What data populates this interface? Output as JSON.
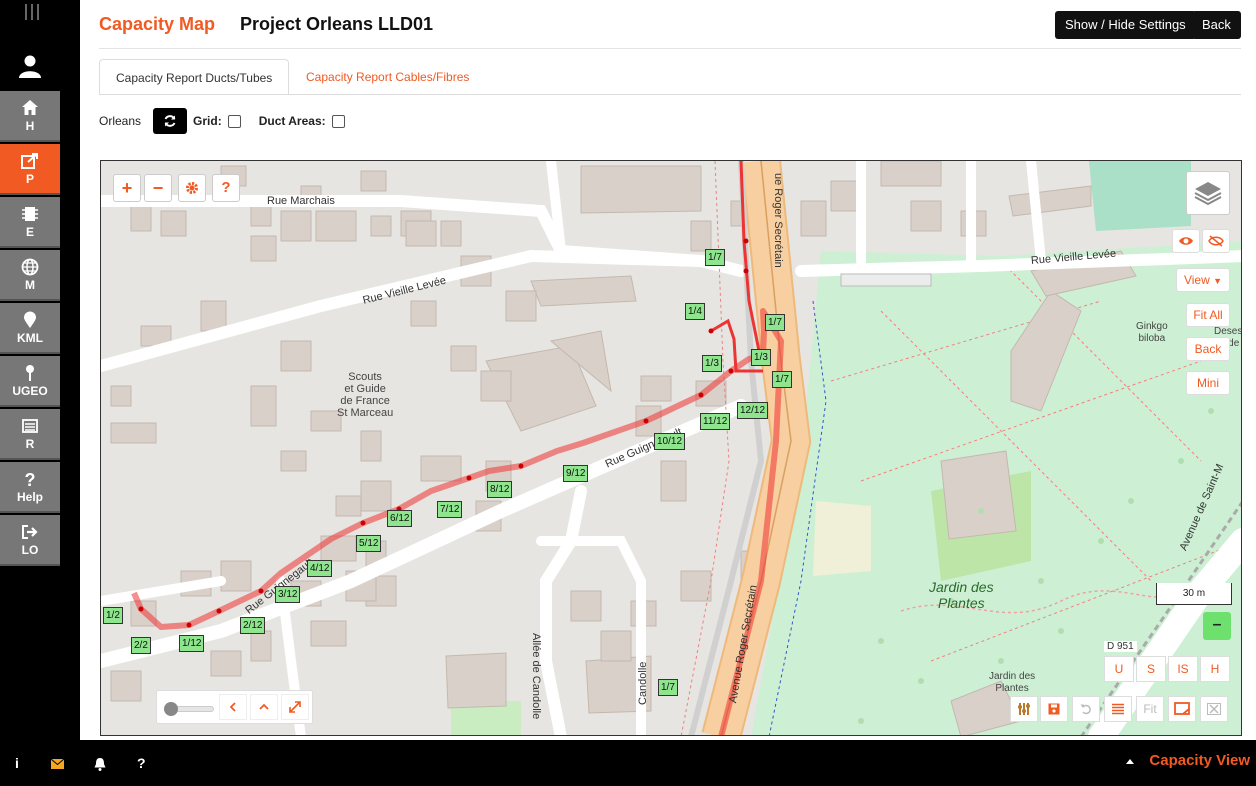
{
  "header": {
    "brand": "Capacity Map",
    "project": "Project Orleans LLD01",
    "show_hide_settings": "Show / Hide Settings",
    "back": "Back"
  },
  "sidebar": {
    "items": [
      {
        "label": "H",
        "icon": "home-icon"
      },
      {
        "label": "P",
        "icon": "share-icon"
      },
      {
        "label": "E",
        "icon": "chip-icon"
      },
      {
        "label": "M",
        "icon": "globe-icon"
      },
      {
        "label": "KML",
        "icon": "pin-icon"
      },
      {
        "label": "UGEO",
        "icon": "small-pin-icon"
      },
      {
        "label": "R",
        "icon": "list-icon"
      },
      {
        "label": "Help",
        "icon": "question-icon"
      },
      {
        "label": "LO",
        "icon": "logout-icon"
      }
    ]
  },
  "tabs": [
    {
      "label": "Capacity Report Ducts/Tubes",
      "active": true
    },
    {
      "label": "Capacity Report Cables/Fibres",
      "active": false
    }
  ],
  "toolbar": {
    "location": "Orleans",
    "grid_label": "Grid:",
    "duct_areas_label": "Duct Areas:"
  },
  "map": {
    "controls": {
      "zoom_in": "+",
      "zoom_out": "−",
      "help": "?"
    },
    "right": {
      "view": "View",
      "fit_all": "Fit All",
      "back": "Back",
      "mini": "Mini"
    },
    "scale": "30 m",
    "road_ref": "D 951",
    "bottom_right": {
      "u": "U",
      "s": "S",
      "is": "IS",
      "h": "H",
      "fit": "Fit"
    },
    "streets": [
      {
        "text": "Rue Marchais"
      },
      {
        "text": "Rue Vieille Levée"
      },
      {
        "text": "Rue Vieille Levée"
      },
      {
        "text": "Rue Guignegault"
      },
      {
        "text": "Rue Guignegault"
      },
      {
        "text": "ue Roger Secrétain"
      },
      {
        "text": "Avenue Roger Secrétain"
      },
      {
        "text": "Allée de Candolle"
      },
      {
        "text": "Candolle"
      },
      {
        "text": "Avenue de Saint-M"
      }
    ],
    "pois": [
      {
        "text": "Scouts\net Guide\nde France\nSt Marceau"
      },
      {
        "text": "Jardin des\nPlantes"
      },
      {
        "text": "Jardin des\nPlantes"
      },
      {
        "text": "Ginkgo\nbiloba"
      },
      {
        "text": "Desespo\nde"
      }
    ],
    "labels": [
      "1/7",
      "1/4",
      "1/7",
      "1/3",
      "1/3",
      "1/7",
      "12/12",
      "11/12",
      "10/12",
      "9/12",
      "8/12",
      "7/12",
      "6/12",
      "5/12",
      "4/12",
      "3/12",
      "2/12",
      "1/12",
      "2/2",
      "1/2",
      "1/7"
    ]
  },
  "footer": {
    "info": "i",
    "help": "?",
    "capacity_view": "Capacity View"
  }
}
